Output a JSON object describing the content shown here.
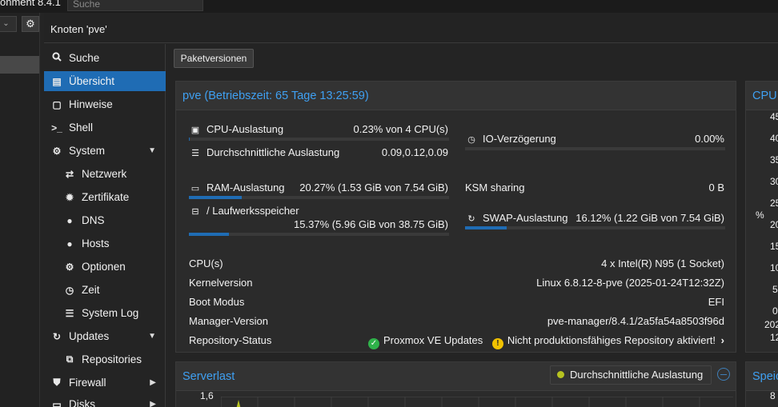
{
  "topbar": {
    "title": "onment 8.4.1",
    "search_placeholder": "Suche"
  },
  "tree": {
    "view_select": "⌄",
    "gear": "⚙"
  },
  "header": {
    "title": "Knoten 'pve'"
  },
  "nav": {
    "items": [
      {
        "label": "Suche",
        "icon": "search-icon",
        "glyph": "🔍"
      },
      {
        "label": "Übersicht",
        "icon": "book-icon",
        "glyph": "▤"
      },
      {
        "label": "Hinweise",
        "icon": "note-icon",
        "glyph": "▢"
      },
      {
        "label": "Shell",
        "icon": "terminal-icon",
        "glyph": ">_"
      },
      {
        "label": "System",
        "icon": "cogs-icon",
        "glyph": "⚙"
      },
      {
        "label": "Netzwerk",
        "icon": "exchange-icon",
        "glyph": "⇄"
      },
      {
        "label": "Zertifikate",
        "icon": "certificate-icon",
        "glyph": "✹"
      },
      {
        "label": "DNS",
        "icon": "globe-icon",
        "glyph": "●"
      },
      {
        "label": "Hosts",
        "icon": "globe-icon",
        "glyph": "●"
      },
      {
        "label": "Optionen",
        "icon": "gear-icon",
        "glyph": "⚙"
      },
      {
        "label": "Zeit",
        "icon": "clock-icon",
        "glyph": "◷"
      },
      {
        "label": "System Log",
        "icon": "list-icon",
        "glyph": "☰"
      },
      {
        "label": "Updates",
        "icon": "refresh-icon",
        "glyph": "↻"
      },
      {
        "label": "Repositories",
        "icon": "repository-icon",
        "glyph": "⧉"
      },
      {
        "label": "Firewall",
        "icon": "shield-icon",
        "glyph": "⛊"
      },
      {
        "label": "Disks",
        "icon": "disk-icon",
        "glyph": "▭"
      }
    ]
  },
  "toolbar": {
    "package_versions": "Paketversionen"
  },
  "status": {
    "title": "pve (Betriebszeit: 65 Tage 13:25:59)",
    "cpu_label": "CPU-Auslastung",
    "cpu_value": "0.23% von 4 CPU(s)",
    "cpu_fraction": 0.0023,
    "load_label": "Durchschnittliche Auslastung",
    "load_value": "0.09,0.12,0.09",
    "io_label": "IO-Verzögerung",
    "io_value": "0.00%",
    "io_fraction": 0.0,
    "ram_label": "RAM-Auslastung",
    "ram_value": "20.27% (1.53 GiB von 7.54 GiB)",
    "ram_fraction": 0.2027,
    "ksm_label": "KSM sharing",
    "ksm_value": "0 B",
    "disk_label": "/ Laufwerksspeicher",
    "disk_value": "15.37% (5.96 GiB von 38.75 GiB)",
    "disk_fraction": 0.1537,
    "swap_label": "SWAP-Auslastung",
    "swap_value": "16.12% (1.22 GiB von 7.54 GiB)",
    "swap_fraction": 0.1612,
    "cpus_label": "CPU(s)",
    "cpus_value": "4 x Intel(R) N95 (1 Socket)",
    "kernel_label": "Kernelversion",
    "kernel_value": "Linux 6.8.12-8-pve (2025-01-24T12:32Z)",
    "boot_label": "Boot Modus",
    "boot_value": "EFI",
    "manager_label": "Manager-Version",
    "manager_value": "pve-manager/8.4.1/2a5fa54a8503f96d",
    "repo_label": "Repository-Status",
    "repo_ok": "Proxmox VE Updates",
    "repo_warn": "Nicht produktionsfähiges Repository aktiviert!"
  },
  "cpu_panel": {
    "title": "CPU",
    "axis_unit": "%",
    "ticks": [
      "45",
      "40",
      "35",
      "30",
      "25",
      "20",
      "15",
      "10",
      "5",
      "0",
      "202",
      "12"
    ]
  },
  "serverload": {
    "title": "Serverlast",
    "legend": "Durchschnittliche Auslastung",
    "y_top": "1,6"
  },
  "storage_panel": {
    "title": "Speic",
    "tick": "8"
  }
}
